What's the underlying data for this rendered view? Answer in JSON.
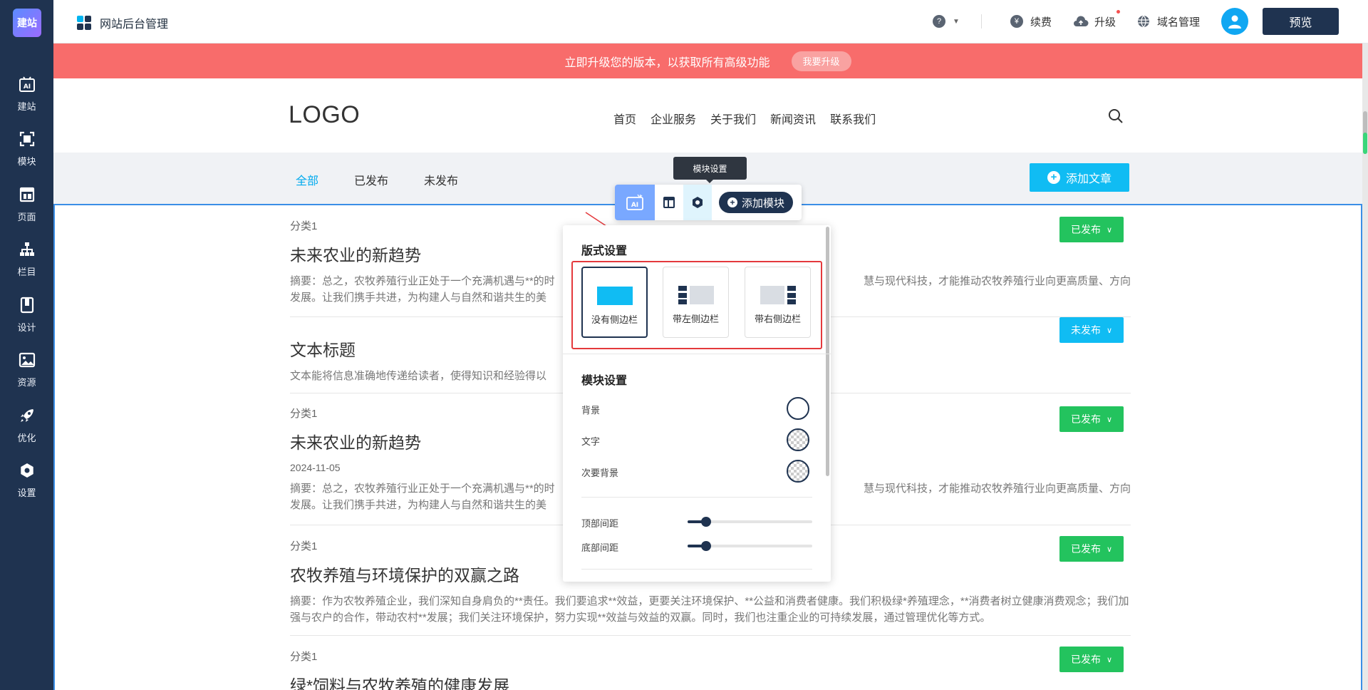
{
  "sidebar": {
    "logo": "建站",
    "items": [
      {
        "label": "建站",
        "icon": "ai-icon"
      },
      {
        "label": "模块",
        "icon": "module-icon"
      },
      {
        "label": "页面",
        "icon": "page-icon"
      },
      {
        "label": "栏目",
        "icon": "sitemap-icon"
      },
      {
        "label": "设计",
        "icon": "design-icon"
      },
      {
        "label": "资源",
        "icon": "image-icon"
      },
      {
        "label": "优化",
        "icon": "rocket-icon"
      },
      {
        "label": "设置",
        "icon": "gear-icon"
      }
    ]
  },
  "header": {
    "title": "网站后台管理",
    "renew": "续费",
    "upgrade": "升级",
    "domain": "域名管理",
    "preview": "预览"
  },
  "promo": {
    "text": "立即升级您的版本，以获取所有高级功能",
    "button": "我要升级"
  },
  "site": {
    "logo": "LOGO",
    "nav": [
      "首页",
      "企业服务",
      "关于我们",
      "新闻资讯",
      "联系我们"
    ]
  },
  "filter": {
    "tabs": [
      "全部",
      "已发布",
      "未发布"
    ],
    "add_article": "添加文章"
  },
  "articles": [
    {
      "category": "分类1",
      "title": "未来农业的新趋势",
      "summary_left": "摘要：总之，农牧养殖行业正处于一个充满机遇与**的时",
      "summary_right": "慧与现代科技，才能推动农牧养殖行业向更高质量、方向",
      "summary_line2": "发展。让我们携手共进，为构建人与自然和谐共生的美",
      "status": "已发布"
    },
    {
      "title": "文本标题",
      "summary_left": "文本能将信息准确地传递给读者，使得知识和经验得以",
      "status": "未发布"
    },
    {
      "category": "分类1",
      "title": "未来农业的新趋势",
      "date": "2024-11-05",
      "summary_left": "摘要：总之，农牧养殖行业正处于一个充满机遇与**的时",
      "summary_right": "慧与现代科技，才能推动农牧养殖行业向更高质量、方向",
      "summary_line2": "发展。让我们携手共进，为构建人与自然和谐共生的美",
      "status": "已发布"
    },
    {
      "category": "分类1",
      "title": "农牧养殖与环境保护的双赢之路",
      "summary_full": "摘要：作为农牧养殖企业，我们深知自身肩负的**责任。我们要追求**效益，更要关注环境保护、**公益和消费者健康。我们积极绿*养殖理念，**消费者树立健康消费观念；我们加强与农户的合作，带动农村**发展；我们关注环境保护，努力实现**效益与效益的双赢。同时，我们也注重企业的可持续发展，通过管理优化等方式。",
      "status": "已发布"
    },
    {
      "category": "分类1",
      "title": "绿*饲料与农牧养殖的健康发展",
      "status": "已发布"
    }
  ],
  "module_toolbar": {
    "tooltip": "模块设置",
    "add_module": "添加模块"
  },
  "panel": {
    "layout_title": "版式设置",
    "layouts": [
      "没有侧边栏",
      "带左侧边栏",
      "带右侧边栏"
    ],
    "module_title": "模块设置",
    "bg": "背景",
    "text": "文字",
    "secondary_bg": "次要背景",
    "top_spacing": "顶部间距",
    "bottom_spacing": "底部间距",
    "top_spacing_value": 0.15,
    "bottom_spacing_value": 0.15
  },
  "colors": {
    "sidebar": "#1f3350",
    "accent": "#10bcf3",
    "published": "#23c35e",
    "promo": "#f86c6b",
    "highlight_box": "#e4393c"
  }
}
